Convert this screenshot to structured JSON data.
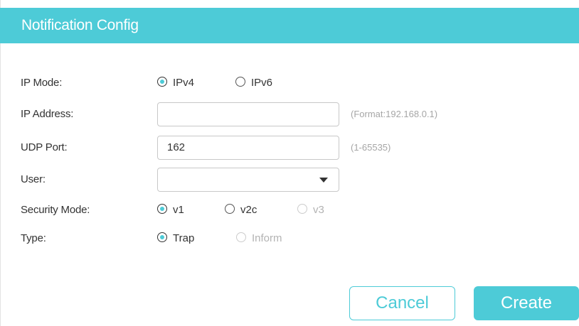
{
  "dialog": {
    "title": "Notification Config"
  },
  "form": {
    "ip_mode": {
      "label": "IP Mode:",
      "options": [
        {
          "label": "IPv4",
          "checked": true,
          "disabled": false
        },
        {
          "label": "IPv6",
          "checked": false,
          "disabled": false
        }
      ]
    },
    "ip_address": {
      "label": "IP Address:",
      "value": "",
      "hint": "(Format:192.168.0.1)"
    },
    "udp_port": {
      "label": "UDP Port:",
      "value": "162",
      "hint": "(1-65535)"
    },
    "user": {
      "label": "User:",
      "value": ""
    },
    "security_mode": {
      "label": "Security Mode:",
      "options": [
        {
          "label": "v1",
          "checked": true,
          "disabled": false
        },
        {
          "label": "v2c",
          "checked": false,
          "disabled": false
        },
        {
          "label": "v3",
          "checked": false,
          "disabled": true
        }
      ]
    },
    "type": {
      "label": "Type:",
      "options": [
        {
          "label": "Trap",
          "checked": true,
          "disabled": false
        },
        {
          "label": "Inform",
          "checked": false,
          "disabled": true
        }
      ]
    }
  },
  "buttons": {
    "cancel_label": "Cancel",
    "create_label": "Create"
  },
  "colors": {
    "accent": "#4dcbd7",
    "text": "#333333",
    "hint": "#a6a6a6",
    "disabled": "#b3b3b3"
  }
}
